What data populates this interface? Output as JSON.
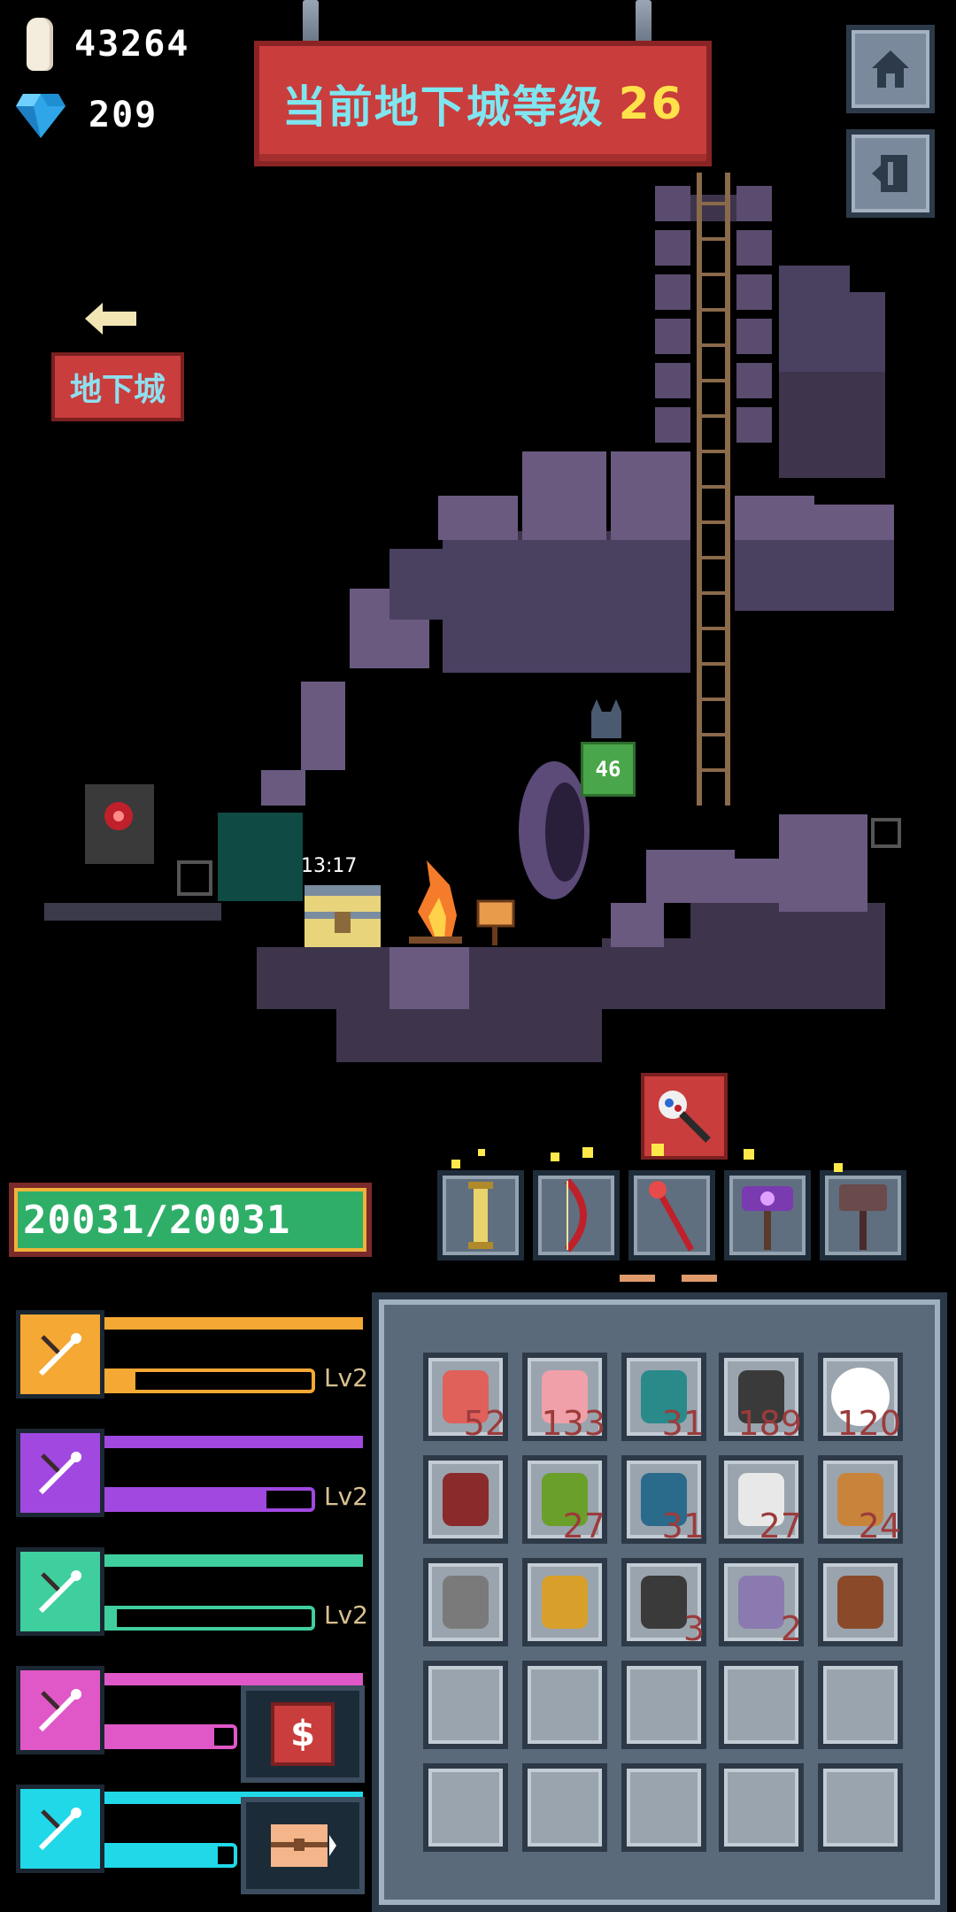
{
  "resources": {
    "coins": "43264",
    "gems": "209"
  },
  "banner": {
    "text": "当前地下城等级",
    "level": "26"
  },
  "nav": {
    "dungeon_label": "地下城"
  },
  "scene": {
    "chest_timer": "13:17",
    "player_level": "46"
  },
  "health": {
    "text": "20031/20031"
  },
  "equipment": [
    "golden-scroll",
    "red-bow",
    "red-staff",
    "purple-hammer",
    "brown-hammer"
  ],
  "skills": [
    {
      "icon": "swords-icon",
      "color": "#f5a833",
      "level_label": "Lv2",
      "progress": 0.15
    },
    {
      "icon": "arrows-icon",
      "color": "#a048e0",
      "level_label": "Lv2",
      "progress": 0.78
    },
    {
      "icon": "tools-icon",
      "color": "#3fcf9e",
      "level_label": "Lv2",
      "progress": 0.06
    },
    {
      "icon": "pickaxe-icon",
      "color": "#e058c8",
      "level_label": "",
      "progress": 0.85
    },
    {
      "icon": "axe-icon",
      "color": "#20d8e8",
      "level_label": "",
      "progress": 0.88
    }
  ],
  "inventory": {
    "row1": [
      {
        "item": "red-potion",
        "qty": "52"
      },
      {
        "item": "pink-potion",
        "qty": "133"
      },
      {
        "item": "teal-potion",
        "qty": "31"
      },
      {
        "item": "ore-stone",
        "qty": "189"
      },
      {
        "item": "white-orb",
        "qty": "120"
      }
    ],
    "row2": [
      {
        "item": "spell-book",
        "qty": ""
      },
      {
        "item": "green-jar",
        "qty": "27"
      },
      {
        "item": "blue-bottle",
        "qty": "31"
      },
      {
        "item": "white-bottle",
        "qty": "27"
      },
      {
        "item": "gourd",
        "qty": "24"
      }
    ],
    "row3": [
      {
        "item": "ring",
        "qty": ""
      },
      {
        "item": "gold-shield",
        "qty": ""
      },
      {
        "item": "dark-stone",
        "qty": "3"
      },
      {
        "item": "purple-map",
        "qty": "2"
      },
      {
        "item": "rune-book",
        "qty": ""
      }
    ]
  }
}
